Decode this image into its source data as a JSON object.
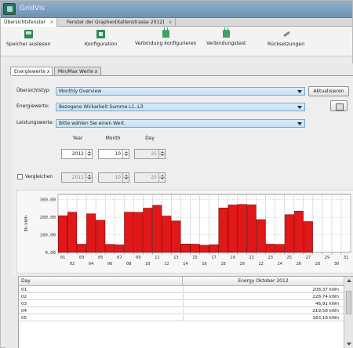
{
  "window": {
    "title": "GridVis"
  },
  "tabs": [
    {
      "label": "Übersichtsfenster",
      "close": "x"
    },
    {
      "label": "Fenster der Graphen[Kaltenstrasse 2012]",
      "close": "x"
    }
  ],
  "toolbar": {
    "items": [
      {
        "label": "Speicher auslesen",
        "icon": "memory-read-icon"
      },
      {
        "label": "Konfiguration",
        "icon": "configuration-icon"
      },
      {
        "label": "Verbindung konfigurieren",
        "icon": "plug-icon"
      },
      {
        "label": "Verbindungstest",
        "icon": "plug-icon"
      },
      {
        "label": "Rücksetzungen",
        "icon": "eraser-icon"
      }
    ]
  },
  "subtabs": [
    {
      "label": "Energiewerte",
      "close": "x"
    },
    {
      "label": "Min/Max Werte",
      "close": "x"
    }
  ],
  "form": {
    "uebersichtstyp_label": "Übersichtstyp:",
    "uebersichtstyp_value": "Monthly Overview",
    "energiewerte_label": "Energiewerte:",
    "energiewerte_value": "Bezogene Wirkarbeit Summe L1..L3",
    "leistungswerte_label": "Leistungswerte:",
    "leistungswerte_value": "Bitte wählen Sie einen Wert.",
    "refresh_button": "Aktualisieren",
    "col_year": "Year",
    "col_month": "Month",
    "col_day": "Day",
    "year": "2012",
    "month": "10",
    "day": "25",
    "compare_label": "Vergleichen",
    "compare_year": "2011",
    "compare_month": "10",
    "compare_day": "25"
  },
  "chart_data": {
    "type": "bar",
    "ylabel": "Eh kWh",
    "ylim": [
      0,
      330
    ],
    "yticks": [
      "0,00",
      "100,00",
      "200,00",
      "300,00"
    ],
    "categories": [
      "01",
      "02",
      "03",
      "04",
      "05",
      "06",
      "07",
      "08",
      "09",
      "10",
      "11",
      "12",
      "13",
      "14",
      "15",
      "16",
      "17",
      "18",
      "19",
      "20",
      "21",
      "22",
      "23",
      "24",
      "25",
      "26",
      "27",
      "28",
      "29",
      "30",
      "31"
    ],
    "values": [
      208.37,
      228.74,
      46.91,
      219.58,
      183.18,
      46,
      43,
      229,
      228,
      252,
      268,
      207,
      179,
      48,
      47,
      41,
      44,
      253,
      270,
      273,
      271,
      186,
      47,
      46,
      215,
      235,
      176,
      0,
      0,
      0,
      0
    ],
    "colors": {
      "bar": "#e01818",
      "bar_edge": "#7a0000",
      "grid": "#c8c8c8"
    }
  },
  "table": {
    "headers": [
      "Day",
      "Energy Oktober 2012"
    ],
    "rows": [
      {
        "day": "01",
        "value": "208,37 kWh"
      },
      {
        "day": "02",
        "value": "228,74 kWh"
      },
      {
        "day": "03",
        "value": "46,91 kWh"
      },
      {
        "day": "04",
        "value": "219,58 kWh"
      },
      {
        "day": "05",
        "value": "183,18 kWh"
      }
    ]
  }
}
